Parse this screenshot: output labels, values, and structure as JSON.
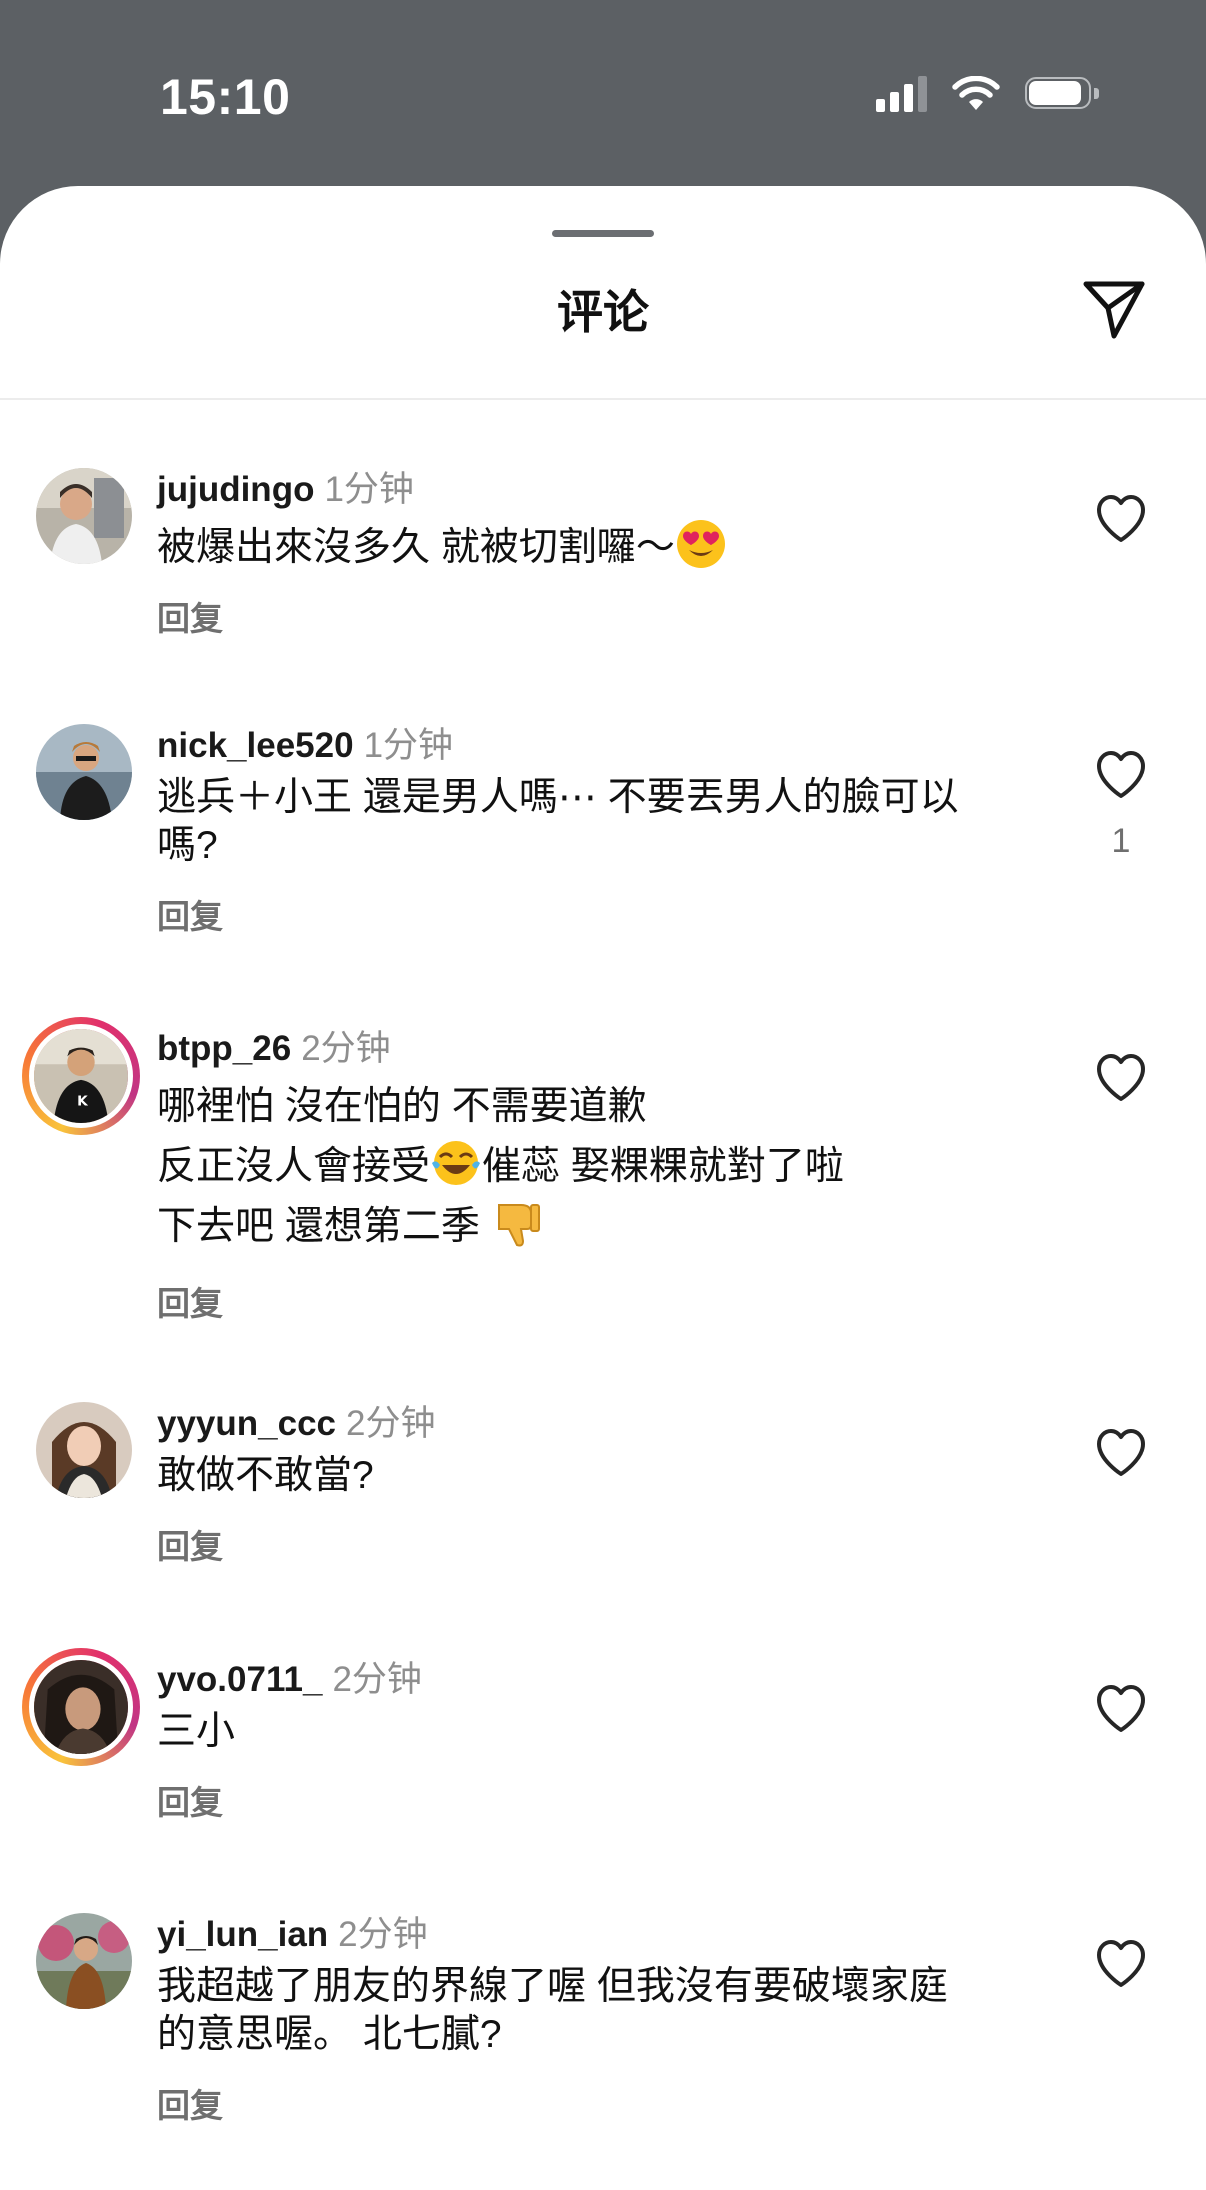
{
  "status_bar": {
    "time": "15:10"
  },
  "sheet": {
    "title": "评论",
    "send_icon": "paper-plane-icon"
  },
  "comments": [
    {
      "username": "jujudingo",
      "time": "1分钟",
      "lines": [
        "被爆出來沒多久 就被切割囉～"
      ],
      "emoji": "heart-eyes-emoji",
      "reply_label": "回复",
      "likes": "",
      "story_ring": false
    },
    {
      "username": "nick_lee520",
      "time": "1分钟",
      "lines": [
        "逃兵＋小王 還是男人嗎⋯ 不要丟男人的臉可以",
        "嗎?"
      ],
      "reply_label": "回复",
      "likes": "1",
      "story_ring": false
    },
    {
      "username": "btpp_26",
      "time": "2分钟",
      "lines": [
        "哪裡怕 沒在怕的 不需要道歉",
        "反正沒人會接受",
        "催蕊 娶粿粿就對了啦",
        "下去吧 還想第二季"
      ],
      "emojis": [
        "tears-of-joy-emoji",
        "thumbs-down-emoji"
      ],
      "reply_label": "回复",
      "likes": "",
      "story_ring": true
    },
    {
      "username": "yyyun_ccc",
      "time": "2分钟",
      "lines": [
        "敢做不敢當?"
      ],
      "reply_label": "回复",
      "likes": "",
      "story_ring": false
    },
    {
      "username": "yvo.0711_",
      "time": "2分钟",
      "lines": [
        "三小"
      ],
      "reply_label": "回复",
      "likes": "",
      "story_ring": true
    },
    {
      "username": "yi_lun_ian",
      "time": "2分钟",
      "lines": [
        "我超越了朋友的界線了喔  但我沒有要破壞家庭",
        "的意思喔。 北七膩?"
      ],
      "reply_label": "回复",
      "likes": "",
      "story_ring": false
    }
  ],
  "colors": {
    "status_bar_bg": "#5c6064",
    "sheet_bg": "#ffffff",
    "secondary_text": "#8e8e8e"
  }
}
